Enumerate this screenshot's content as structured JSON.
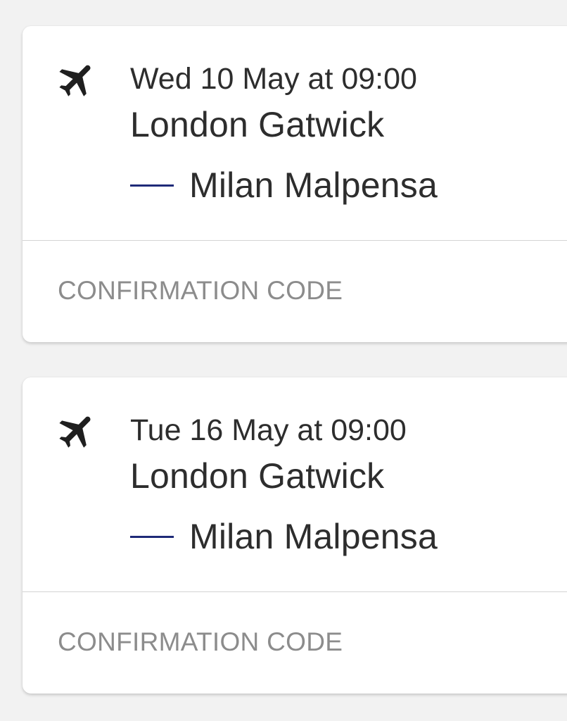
{
  "bookings": [
    {
      "icon": "airplane-icon",
      "date": "Wed 10 May at 09:00",
      "origin": "London Gatwick",
      "destination": "Milan Malpensa",
      "confirmation_label": "CONFIRMATION CODE"
    },
    {
      "icon": "airplane-icon",
      "date": "Tue 16 May at 09:00",
      "origin": "London Gatwick",
      "destination": "Milan Malpensa",
      "confirmation_label": "CONFIRMATION CODE"
    }
  ],
  "colors": {
    "background": "#f2f2f2",
    "card": "#ffffff",
    "text": "#2d2d2d",
    "muted_text": "#8c8c8c",
    "route_dash": "#1e2a78",
    "divider": "#d4d4d4"
  }
}
